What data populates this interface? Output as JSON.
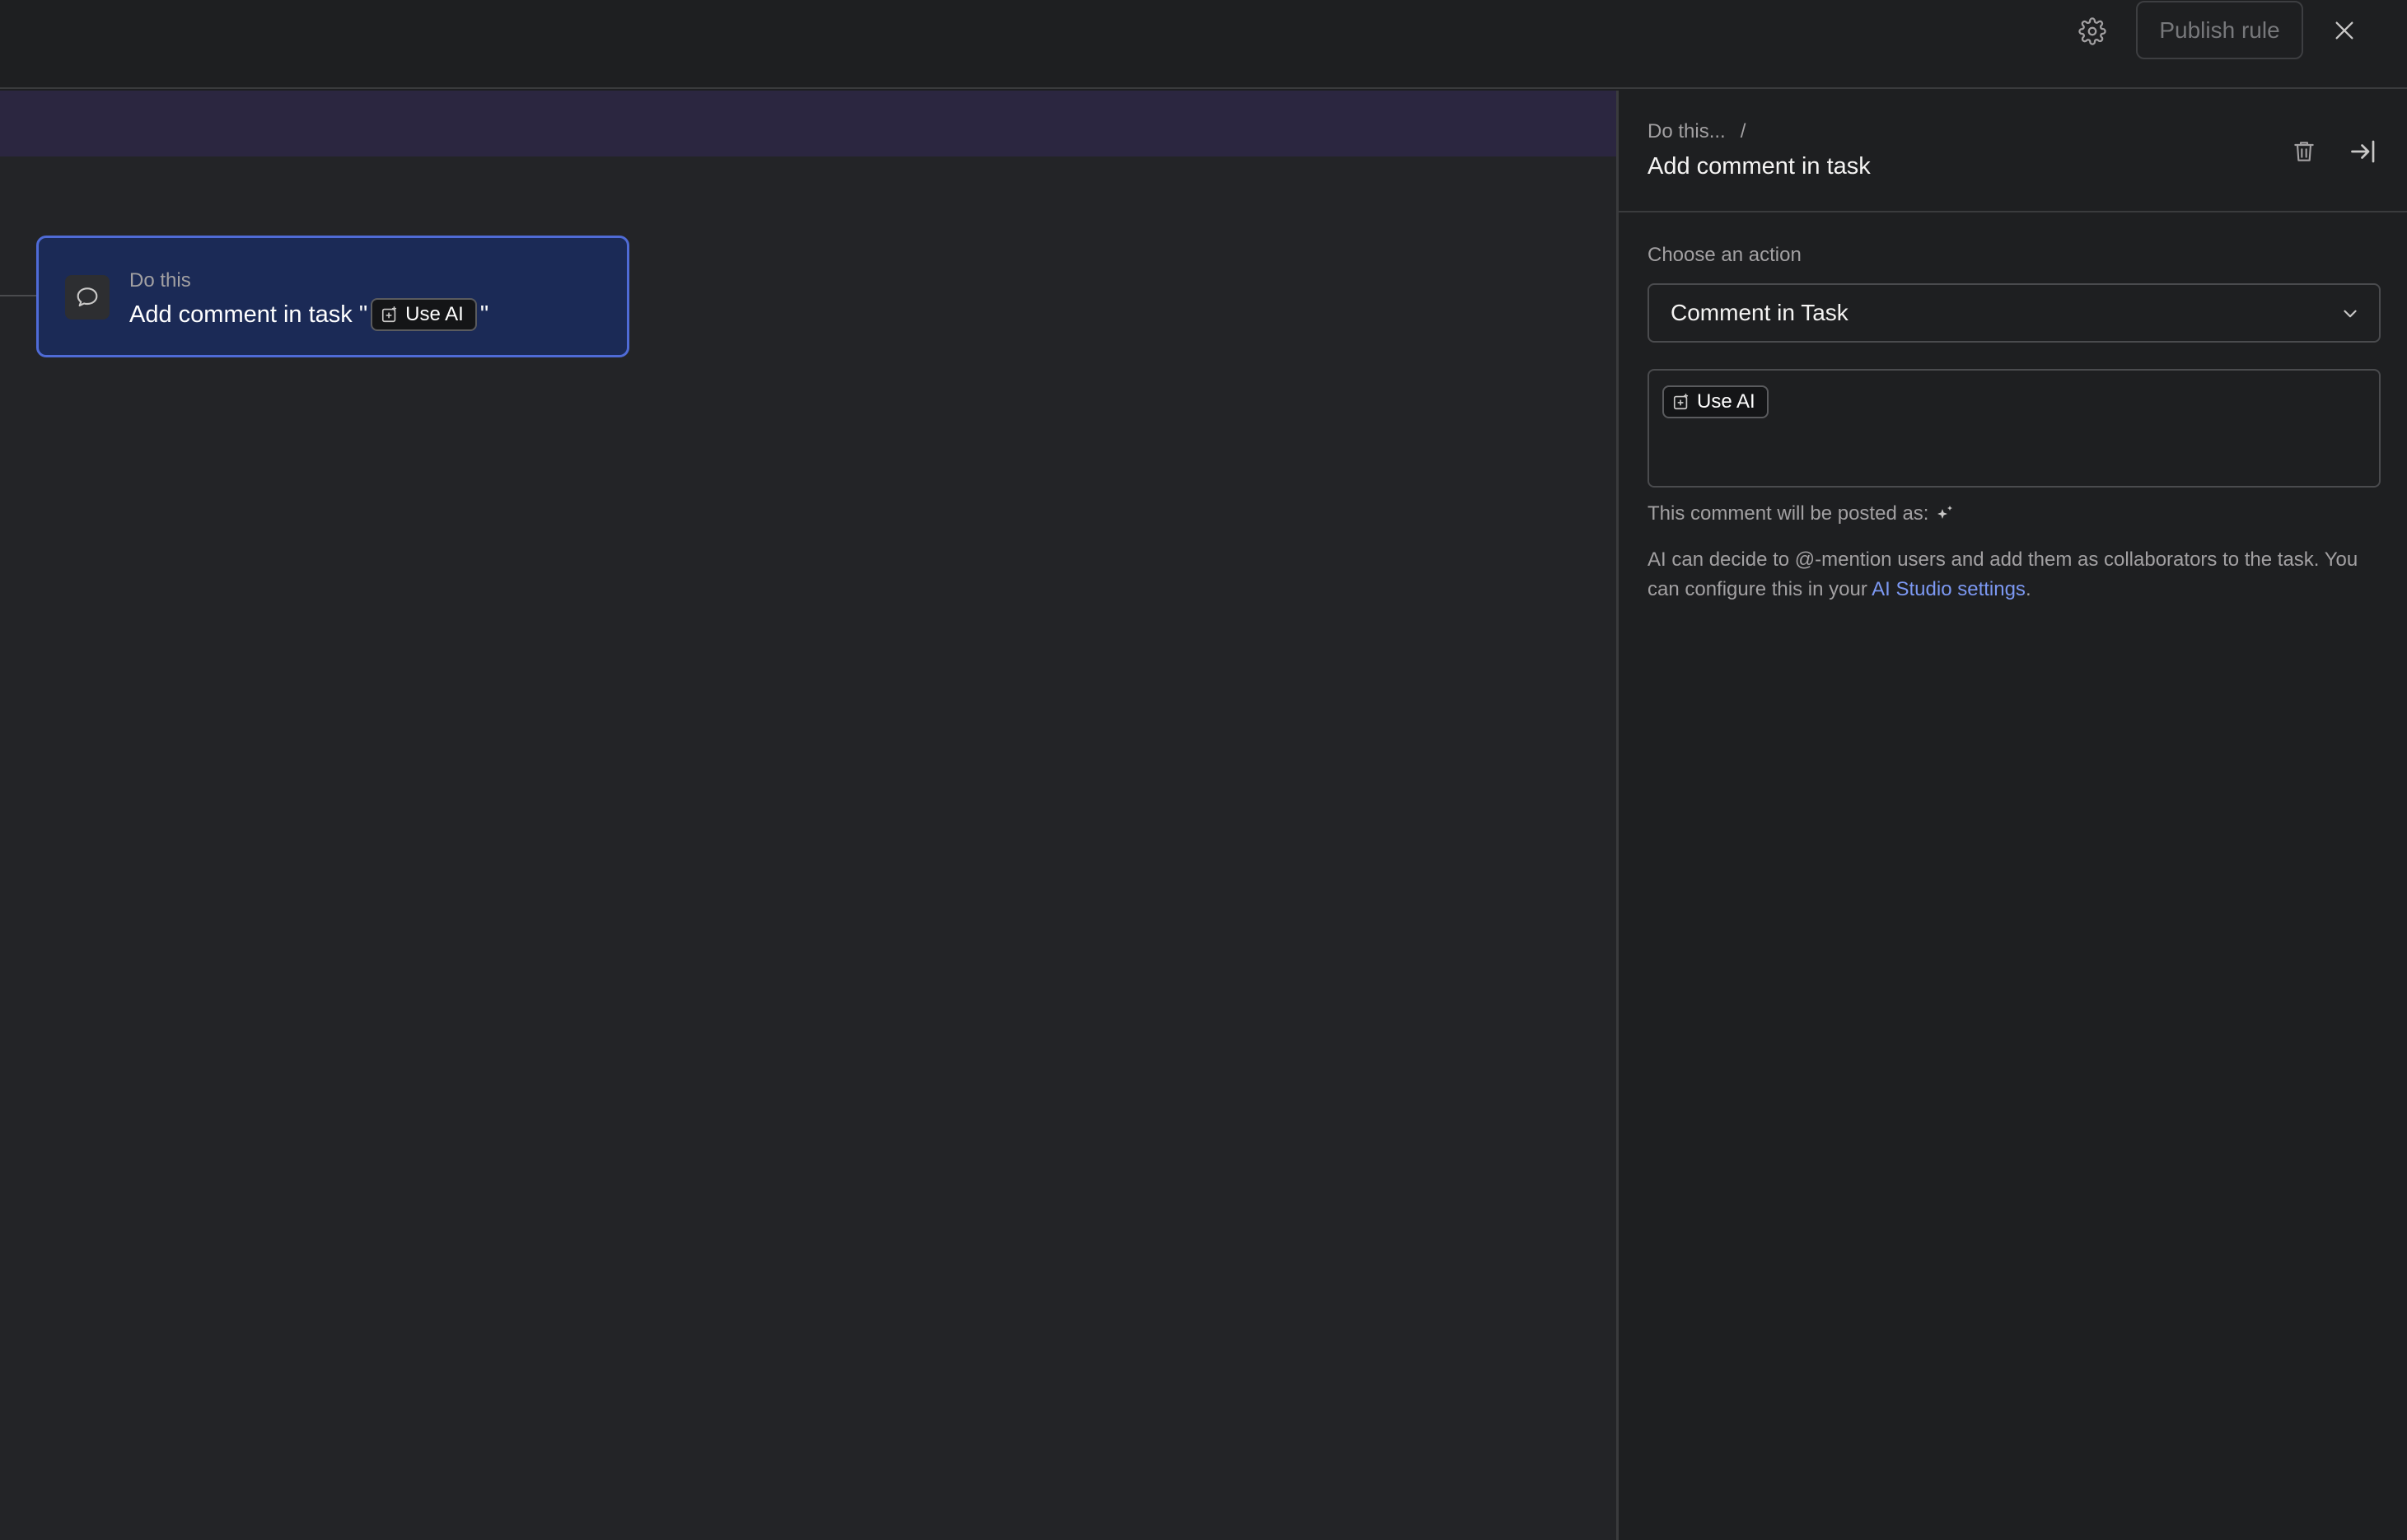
{
  "topbar": {
    "settings_icon": "gear-icon",
    "publish_label": "Publish rule",
    "close_icon": "close-icon"
  },
  "canvas": {
    "band_color": "#2b2640",
    "node": {
      "icon": "comment-bubble-icon",
      "kicker": "Do this",
      "title_prefix": "Add comment in task \"",
      "chip_label": "Use AI",
      "title_suffix": "\"",
      "accent": "#4f6bd6"
    }
  },
  "panel": {
    "breadcrumb_parent": "Do this...",
    "breadcrumb_sep": "/",
    "title": "Add comment in task",
    "delete_icon": "trash-icon",
    "collapse_icon": "collapse-right-icon",
    "action_label": "Choose an action",
    "action_value": "Comment in Task",
    "editor_chip_label": "Use AI",
    "posted_as_label": "This comment will be posted as:",
    "posted_as_icon": "sparkle-icon",
    "ai_note_text": "AI can decide to @-mention users and add them as collaborators to the task. You can configure this in your ",
    "ai_note_link": "AI Studio settings",
    "ai_note_end": ".",
    "link_color": "#7c98f2"
  }
}
